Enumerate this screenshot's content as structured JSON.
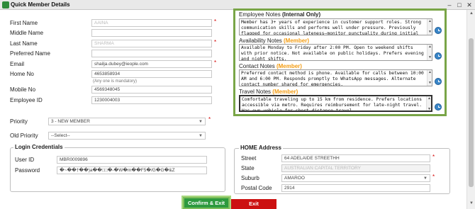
{
  "window": {
    "title": "Quick Member Details"
  },
  "member": {
    "first_name_label": "First Name",
    "first_name": "AAINA",
    "middle_name_label": "Middle Name",
    "middle_name": "",
    "last_name_label": "Last Name",
    "last_name": "SHARMA",
    "preferred_name_label": "Preferred Name",
    "preferred_name": "",
    "email_label": "Email",
    "email": "shailja.dubey@ieople.com",
    "home_no_label": "Home No",
    "home_no": "4653858934",
    "phone_hint": "(Any one is mandatory)",
    "mobile_no_label": "Mobile No",
    "mobile_no": "4569348045",
    "employee_id_label": "Employee ID",
    "employee_id": "1230004003",
    "priority_label": "Priority",
    "priority": "3 - NEW MEMBER",
    "old_priority_label": "Old Priority",
    "old_priority": "--Select--"
  },
  "notes": {
    "employee": {
      "label": "Employee Notes",
      "suffix": "(Internal Only)",
      "text": "Member has 3+ years of experience in customer support roles. Strong communication skills and performs well under pressure. Previously flagged for occasional lateness—monitor punctuality during initial"
    },
    "availability": {
      "label": "Availability Notes",
      "suffix": "(Member)",
      "text": "Available Monday to Friday after 2:00 PM. Open to weekend shifts with prior notice. Not available on public holidays. Prefers evening and night shifts."
    },
    "contact": {
      "label": "Contact Notes",
      "suffix": "(Member)",
      "text": "Preferred contact method is phone. Available for calls between 10:00 AM and 6:00 PM. Responds promptly to WhatsApp messages. Alternate contact number shared for emergencies."
    },
    "travel": {
      "label": "Travel Notes",
      "suffix": "(Member)",
      "text": "Comfortable traveling up to 15 km from residence. Prefers locations accessible via metro. Requires reimbursement for late-night travel. Has own vehicle for short-distance travel."
    }
  },
  "login": {
    "title": "Login Credentials",
    "user_id_label": "User ID",
    "user_id": "MBR0009896",
    "password_label": "Password",
    "password": "�~��†��)a��□□�-�W�m��F5�/G�G�&Z"
  },
  "address": {
    "title": "HOME Address",
    "street_label": "Street",
    "street": "64 ADELAIDE STREETHH",
    "state_label": "State",
    "state": "AUSTRALIAN CAPITAL TERRITORY",
    "suburb_label": "Suburb",
    "suburb": "AMAROO",
    "postcode_label": "Postal Code",
    "postcode": "2914"
  },
  "actions": {
    "confirm": "Confirm & Exit",
    "exit": "Exit"
  },
  "colors": {
    "notes_border": "#79a547",
    "member_tag": "#f39c12",
    "confirm": "#2d9a3e",
    "exit": "#cc1111"
  }
}
